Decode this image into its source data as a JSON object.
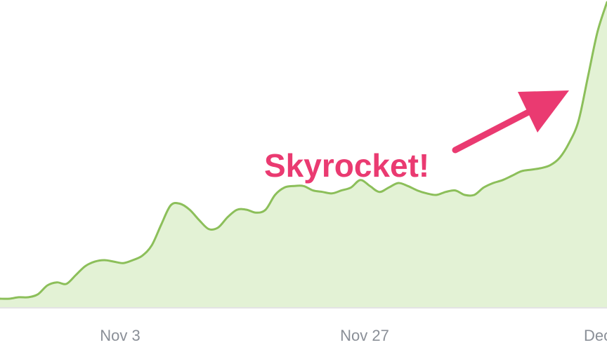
{
  "chart_data": {
    "type": "area",
    "title": "",
    "xlabel": "",
    "ylabel": "",
    "x_ticks": [
      "Nov 3",
      "Nov 27",
      "Dec"
    ],
    "x": [
      -12,
      -11,
      -10,
      -9,
      -8,
      -7,
      -6,
      -5,
      -4,
      -3,
      -2,
      -1,
      0,
      1,
      2,
      3,
      4,
      5,
      6,
      7,
      8,
      9,
      10,
      11,
      12,
      13,
      14,
      15,
      16,
      17,
      18,
      19,
      20,
      21,
      22,
      23,
      24,
      25,
      26,
      27,
      28,
      29,
      30,
      31,
      32,
      33,
      34,
      35,
      36,
      37,
      38,
      39,
      40,
      41,
      42,
      43,
      44,
      45,
      46,
      47,
      48,
      49,
      50,
      51,
      52
    ],
    "series": [
      {
        "values": [
          0,
          0,
          1,
          1,
          3,
          9,
          11,
          10,
          16,
          22,
          25,
          26,
          25,
          24,
          26,
          29,
          36,
          50,
          63,
          64,
          60,
          53,
          47,
          48,
          55,
          60,
          60,
          58,
          60,
          70,
          75,
          76,
          76,
          73,
          72,
          71,
          73,
          75,
          80,
          76,
          72,
          75,
          78,
          76,
          73,
          71,
          70,
          72,
          73,
          70,
          70,
          75,
          78,
          80,
          83,
          86,
          87,
          88,
          90,
          95,
          105,
          120,
          150,
          180,
          200
        ]
      }
    ],
    "ylim": [
      0,
      200
    ],
    "annotations": [
      {
        "text": "Skyrocket!"
      }
    ],
    "colors": {
      "line": "#8cbf5a",
      "fill": "#e3f2d5",
      "axis": "#e4e4e4",
      "tick_text": "#8a8f97",
      "annotation": "#ea3a71"
    },
    "grid": false,
    "legend": "none"
  }
}
